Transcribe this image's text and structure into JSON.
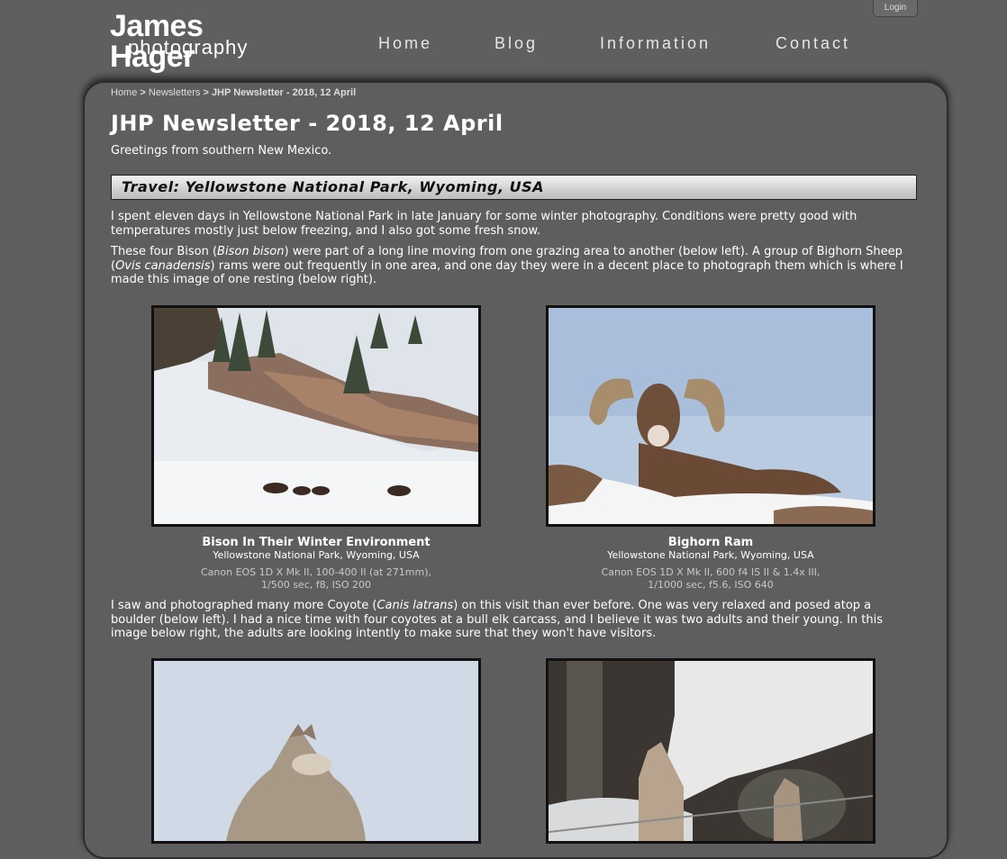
{
  "header": {
    "logo_line1": "James Hager",
    "logo_line2": "photography",
    "login_label": "Login",
    "nav": [
      "Home",
      "Blog",
      "Information",
      "Contact"
    ]
  },
  "breadcrumb": {
    "home": "Home",
    "sep1": ">",
    "newsletters": "Newsletters",
    "sep2": ">",
    "current": "JHP Newsletter - 2018, 12 April"
  },
  "page": {
    "title": "JHP Newsletter - 2018, 12 April",
    "greeting": "Greetings from southern New Mexico.",
    "section_title": "Travel: Yellowstone National Park, Wyoming, USA",
    "para1": "I spent eleven days in Yellowstone National Park in late January for some winter photography. Conditions were pretty good with temperatures mostly just below freezing, and I also got some fresh snow.",
    "para2_a": "These four Bison (",
    "para2_b": "Bison bison",
    "para2_c": ") were part of a long line moving from one grazing area to another (below left). A group of Bighorn Sheep (",
    "para2_d": "Ovis canadensis",
    "para2_e": ") rams were out frequently in one area, and one day they were in a decent place to photograph them which is where I made this image of one resting (below right).",
    "para3_a": "I saw and photographed many more Coyote (",
    "para3_b": "Canis latrans",
    "para3_c": ") on this visit than ever before. One was very relaxed and posed atop a boulder (below left). I had a nice time with four coyotes at a bull elk carcass, and I believe it was two adults and their young. In this image below right, the adults are looking intently to make sure that they won't have visitors."
  },
  "figures": [
    {
      "title": "Bison In Their Winter Environment",
      "location": "Yellowstone National Park, Wyoming, USA",
      "camera_line1": "Canon EOS 1D X Mk II, 100-400 II (at 271mm),",
      "camera_line2": "1/500 sec, f8, ISO 200"
    },
    {
      "title": "Bighorn Ram",
      "location": "Yellowstone National Park, Wyoming, USA",
      "camera_line1": "Canon EOS 1D X Mk II, 600 f4 IS II & 1.4x III,",
      "camera_line2": "1/1000 sec, f5.6, ISO 640"
    }
  ]
}
